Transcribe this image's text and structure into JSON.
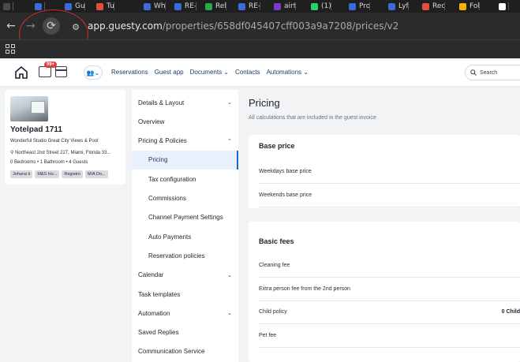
{
  "browser": {
    "tabs": [
      {
        "label": "",
        "color": "#4a4a4a"
      },
      {
        "label": "",
        "color": "#3b6ad9"
      },
      {
        "label": "Gu",
        "color": "#3b6ad9"
      },
      {
        "label": "Tu",
        "color": "#e2503a"
      },
      {
        "label": "Wh",
        "color": "#3b6ad9"
      },
      {
        "label": "RE-",
        "color": "#3b6ad9"
      },
      {
        "label": "Rel",
        "color": "#2da84a"
      },
      {
        "label": "RE-",
        "color": "#3b6ad9"
      },
      {
        "label": "airt",
        "color": "#7a3cc8"
      },
      {
        "label": "(1)",
        "color": "#25d366"
      },
      {
        "label": "Pro",
        "color": "#3b6ad9"
      },
      {
        "label": "Lyf",
        "color": "#3b6ad9"
      },
      {
        "label": "Rec",
        "color": "#e2503a"
      },
      {
        "label": "Fol",
        "color": "#f4b400"
      },
      {
        "label": "",
        "color": "#ffffff"
      }
    ],
    "url_host": "app.guesty.com",
    "url_path": "/properties/658df045407cff003a9a7208/prices/v2",
    "back_icon": "←",
    "forward_icon": "→",
    "reload_icon": "⟳",
    "site_info_icon": "⚙"
  },
  "topnav": {
    "badge": "99+",
    "user_menu_icon": "👥⌄",
    "links": [
      "Reservations",
      "Guest app",
      "Documents ⌄",
      "Contacts",
      "Automations ⌄"
    ],
    "search_placeholder": "Search"
  },
  "property": {
    "title": "Yotelpad 1711",
    "subtitle": "Wonderful Studio Great City Views & Pool",
    "address": "Northeast 2nd Street 227, Miami, Florida 33...",
    "details": "0 Bedrooms • 1 Bathroom • 4 Guests",
    "tags": [
      "Johana k",
      "M&S Ho...",
      "Registro",
      "MIA Do..."
    ]
  },
  "sidenav": {
    "items": [
      {
        "label": "Details & Layout",
        "sub": false,
        "chevron": "⌄",
        "active": false
      },
      {
        "label": "Overview",
        "sub": false,
        "chevron": "",
        "active": false
      },
      {
        "label": "Pricing & Policies",
        "sub": false,
        "chevron": "⌃",
        "active": false
      },
      {
        "label": "Pricing",
        "sub": true,
        "chevron": "",
        "active": true
      },
      {
        "label": "Tax configuration",
        "sub": true,
        "chevron": "",
        "active": false
      },
      {
        "label": "Commissions",
        "sub": true,
        "chevron": "",
        "active": false
      },
      {
        "label": "Channel Payment Settings",
        "sub": true,
        "chevron": "",
        "active": false
      },
      {
        "label": "Auto Payments",
        "sub": true,
        "chevron": "",
        "active": false
      },
      {
        "label": "Reservation policies",
        "sub": true,
        "chevron": "",
        "active": false
      },
      {
        "label": "Calendar",
        "sub": false,
        "chevron": "⌄",
        "active": false
      },
      {
        "label": "Task templates",
        "sub": false,
        "chevron": "",
        "active": false
      },
      {
        "label": "Automation",
        "sub": false,
        "chevron": "⌄",
        "active": false
      },
      {
        "label": "Saved Replies",
        "sub": false,
        "chevron": "",
        "active": false
      },
      {
        "label": "Communication Service",
        "sub": false,
        "chevron": "",
        "active": false
      }
    ]
  },
  "main": {
    "title": "Pricing",
    "subtitle": "All calculations that are included in the guest invoice",
    "base_price": {
      "title": "Base price",
      "rows": [
        {
          "label": "Weekdays base price",
          "value": ""
        },
        {
          "label": "Weekends base price",
          "value": ""
        }
      ]
    },
    "basic_fees": {
      "title": "Basic fees",
      "rows": [
        {
          "label": "Cleaning fee",
          "value": ""
        },
        {
          "label": "Extra person fee from the 2nd person",
          "value": ""
        },
        {
          "label": "Child policy",
          "value": "0 Child"
        },
        {
          "label": "Pet fee",
          "value": ""
        }
      ]
    }
  }
}
